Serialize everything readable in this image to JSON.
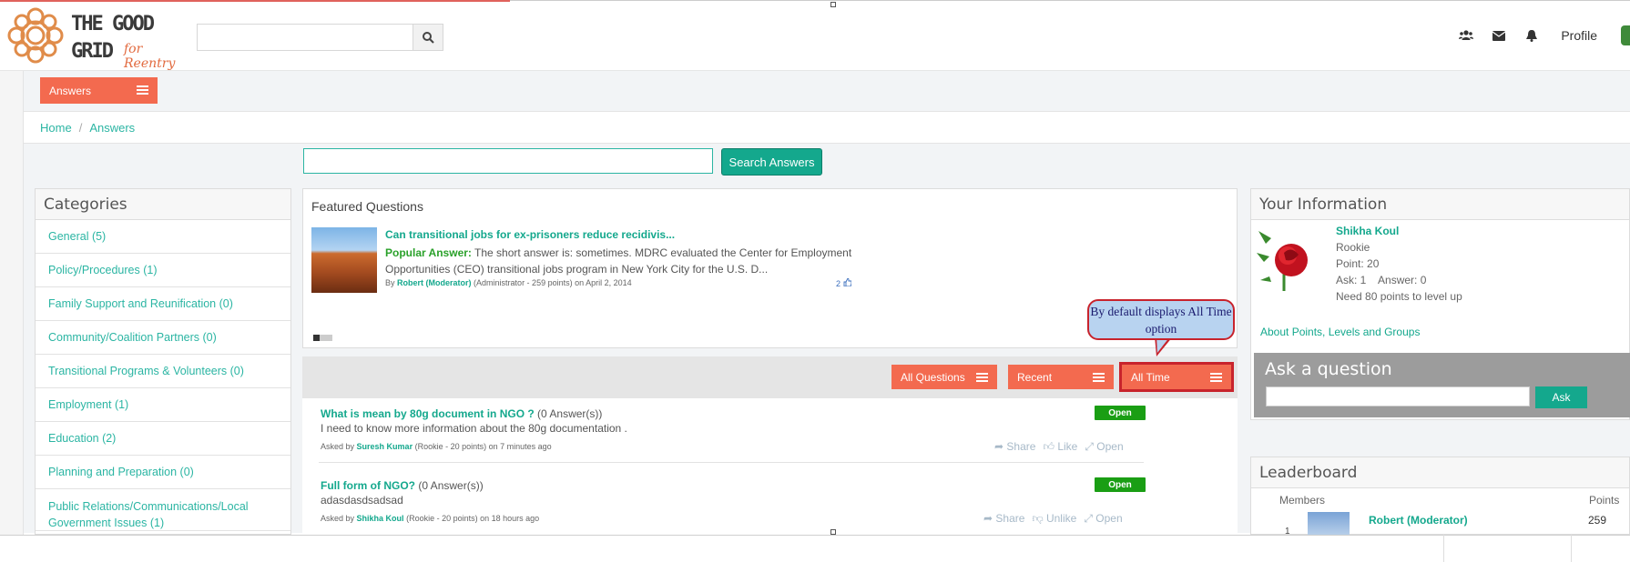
{
  "header": {
    "logo": {
      "line1": "THE GOOD",
      "line2": "GRID",
      "tagline": "for Reentry"
    },
    "search": {
      "placeholder": "",
      "icon": "search-icon"
    },
    "icons": [
      "users-icon",
      "envelope-icon",
      "bell-icon"
    ],
    "profile_label": "Profile"
  },
  "menu": {
    "answers_label": "Answers"
  },
  "breadcrumb": {
    "home": "Home",
    "separator": "/",
    "current": "Answers"
  },
  "answers_search": {
    "placeholder": "",
    "button_label": "Search Answers"
  },
  "categories": {
    "title": "Categories",
    "items": [
      "General (5)",
      "Policy/Procedures (1)",
      "Family Support and Reunification (0)",
      "Community/Coalition Partners (0)",
      "Transitional Programs & Volunteers (0)",
      "Employment (1)",
      "Education (2)",
      "Planning and Preparation (0)",
      "Public Relations/Communications/Local Government Issues (1)"
    ]
  },
  "featured": {
    "title": "Featured Questions",
    "question": "Can transitional jobs for ex-prisoners reduce recidivis...",
    "answer_label": "Popular Answer:",
    "answer_text": "The short answer is: sometimes. MDRC evaluated the Center for Employment Opportunities (CEO) transitional jobs program in New York City for the U.S. D...",
    "meta_by": "By",
    "meta_author": "Robert (Moderator)",
    "meta_role": "(Administrator - 259 points)",
    "meta_date": "on April 2, 2014",
    "votes": "2"
  },
  "filters": {
    "questions": "All Questions",
    "sort": "Recent",
    "time": "All Time"
  },
  "callout": {
    "text": "By default displays All Time option"
  },
  "questions": [
    {
      "title": "What is mean by 80g document in NGO ?",
      "count": "(0 Answer(s))",
      "body": "I need to know more information about the 80g documentation .",
      "asked_by": "Asked by",
      "author": "Suresh Kumar",
      "meta": "(Rookie - 20 points) on 7 minutes ago",
      "status": "Open",
      "actions": [
        "Share",
        "Like",
        "Open"
      ]
    },
    {
      "title": "Full form of NGO?",
      "count": "(0 Answer(s))",
      "body": "adasdasdsadsad",
      "asked_by": "Asked by",
      "author": "Shikha Koul",
      "meta": "(Rookie - 20 points) on 18 hours ago",
      "status": "Open",
      "actions": [
        "Share",
        "Unlike",
        "Open"
      ]
    }
  ],
  "your_info": {
    "title": "Your Information",
    "name": "Shikha Koul",
    "rank": "Rookie",
    "points": "Point: 20",
    "ask_answer": "Ask: 1    Answer: 0",
    "next_level": "Need 80 points to level up",
    "about_link": "About Points, Levels and Groups"
  },
  "ask": {
    "title": "Ask a question",
    "placeholder": "",
    "button_label": "Ask"
  },
  "leaderboard": {
    "title": "Leaderboard",
    "members_label": "Members",
    "points_label": "Points",
    "rows": [
      {
        "rank": "1",
        "name": "Robert (Moderator)",
        "points": "259"
      }
    ]
  },
  "colors": {
    "accent": "#f36a4f",
    "teal": "#14a88d",
    "open": "#1a9e14",
    "callout_border": "#c8232c"
  }
}
